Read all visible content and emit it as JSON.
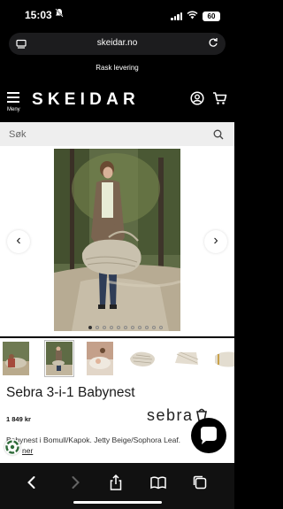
{
  "status_bar": {
    "time": "15:03",
    "battery": "60"
  },
  "browser": {
    "url": "skeidar.no"
  },
  "site": {
    "tagline": "Rask levering",
    "logo": "SKEIDAR",
    "menu_label": "Meny",
    "search_placeholder": "Søk"
  },
  "gallery": {
    "prev_arrow": "‹",
    "next_arrow": "›",
    "dot_count": 11,
    "active_dot": 0,
    "thumbnail_count": 6,
    "selected_thumbnail": 1
  },
  "product": {
    "title": "Sebra 3-i-1 Babynest",
    "price": "1 849 kr",
    "brand": "sebra",
    "description": "Babynest i Bomull/Kapok. Jetty Beige/Sophora Leaf.",
    "read_more": "ner"
  },
  "colors": {
    "accent_black": "#000000",
    "search_bg": "#eeeeee",
    "product_beige": "#c9c1ae"
  }
}
